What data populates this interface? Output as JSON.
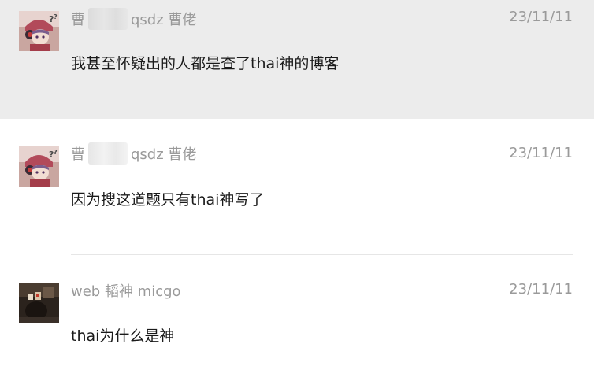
{
  "messages": [
    {
      "sender_prefix": "曹",
      "sender_suffix": "qsdz 曹佬",
      "time": "23/11/11",
      "text": "我甚至怀疑出的人都是查了thai神的博客",
      "avatar": "anime-girl-avatar"
    },
    {
      "sender_prefix": "曹",
      "sender_suffix": "qsdz 曹佬",
      "time": "23/11/11",
      "text": "因为搜这道题只有thai神写了",
      "avatar": "anime-girl-avatar"
    },
    {
      "sender": "web 韬神 micgo",
      "time": "23/11/11",
      "text": "thai为什么是神",
      "avatar": "dark-photo-avatar"
    }
  ],
  "colors": {
    "highlight_bg": "#ececec",
    "meta_text": "#9a9a9a",
    "body_text": "#1a1a1a"
  }
}
